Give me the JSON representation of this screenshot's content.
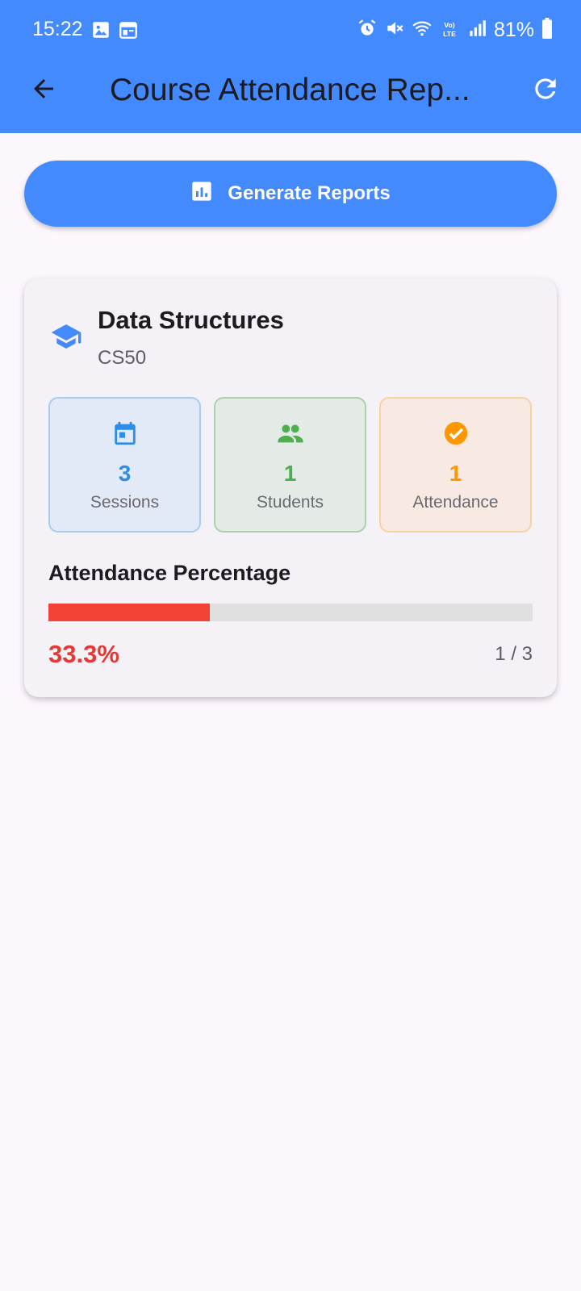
{
  "status_bar": {
    "time": "15:22",
    "battery": "81%",
    "left_icons": [
      "gallery-icon",
      "calendar-icon"
    ],
    "right_icons": [
      "alarm-icon",
      "mute-icon",
      "wifi-icon",
      "volte-icon",
      "signal-icon",
      "battery-icon"
    ]
  },
  "app_bar": {
    "title": "Course Attendance Rep...",
    "back_icon": "arrow-back-icon",
    "refresh_icon": "refresh-icon",
    "background": "#448AFF"
  },
  "generate_button": {
    "label": "Generate Reports",
    "icon": "bar-chart-icon"
  },
  "course": {
    "name": "Data Structures",
    "code": "CS50",
    "icon": "graduation-cap-icon",
    "stats": [
      {
        "value": "3",
        "label": "Sessions",
        "icon": "calendar-icon",
        "color": "#2E8DE6"
      },
      {
        "value": "1",
        "label": "Students",
        "icon": "people-icon",
        "color": "#4CAF50"
      },
      {
        "value": "1",
        "label": "Attendance",
        "icon": "check-circle-icon",
        "color": "#FF9800"
      }
    ],
    "attendance": {
      "title": "Attendance Percentage",
      "percent_text": "33.3%",
      "ratio_text": "1 / 3",
      "fraction": 0.333,
      "bar_color": "#F44336"
    }
  }
}
